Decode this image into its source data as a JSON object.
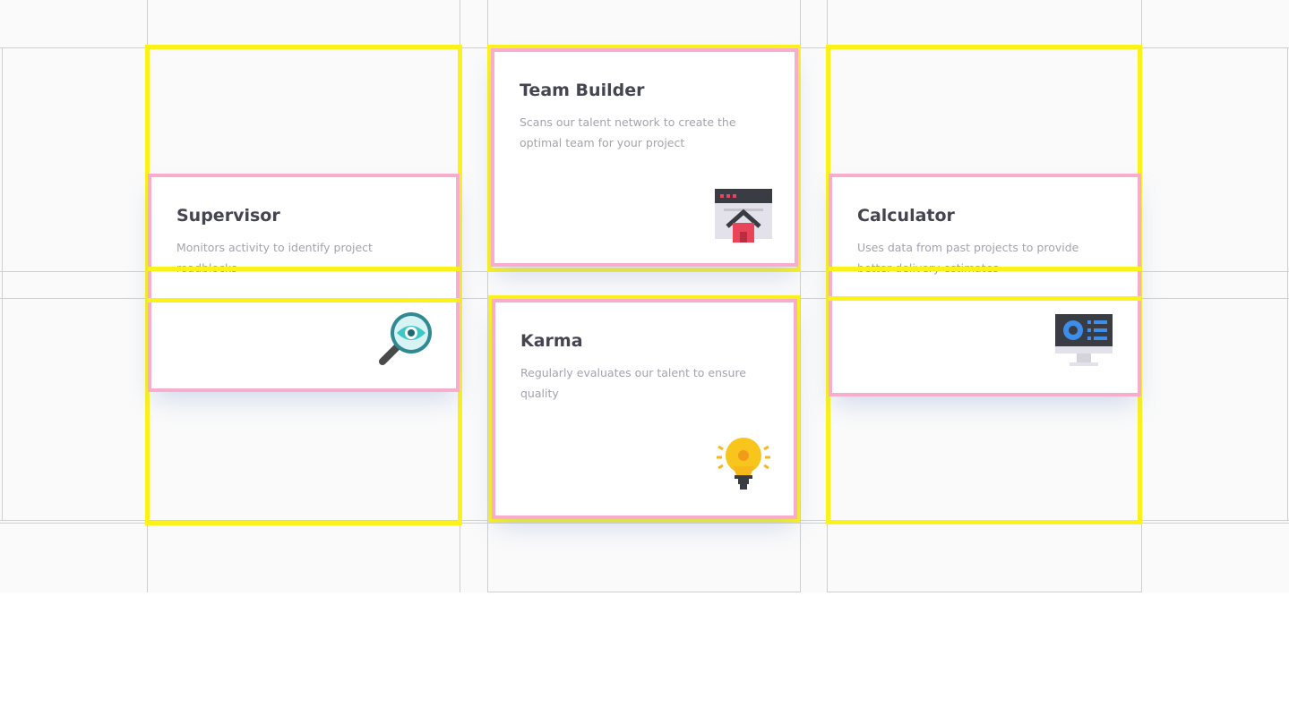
{
  "cards": [
    {
      "id": "supervisor",
      "title": "Supervisor",
      "description": "Monitors activity to identify project roadblocks",
      "icon": "magnifier-eye-icon"
    },
    {
      "id": "team-builder",
      "title": "Team Builder",
      "description": "Scans our talent network to create the optimal team for your project",
      "icon": "browser-house-icon"
    },
    {
      "id": "karma",
      "title": "Karma",
      "description": "Regularly evaluates our talent to ensure quality",
      "icon": "lightbulb-icon"
    },
    {
      "id": "calculator",
      "title": "Calculator",
      "description": "Uses data from past projects to provide better delivery estimates",
      "icon": "monitor-dashboard-icon"
    }
  ],
  "colors": {
    "title": "#454552",
    "description": "#a3a3ad",
    "highlight_yellow": "#fbf21a",
    "highlight_pink": "#f7adcb",
    "accent_red": "#e8455a",
    "accent_teal": "#3cc7c4",
    "accent_yellow": "#f7b81c",
    "accent_blue": "#3c8ee8"
  }
}
